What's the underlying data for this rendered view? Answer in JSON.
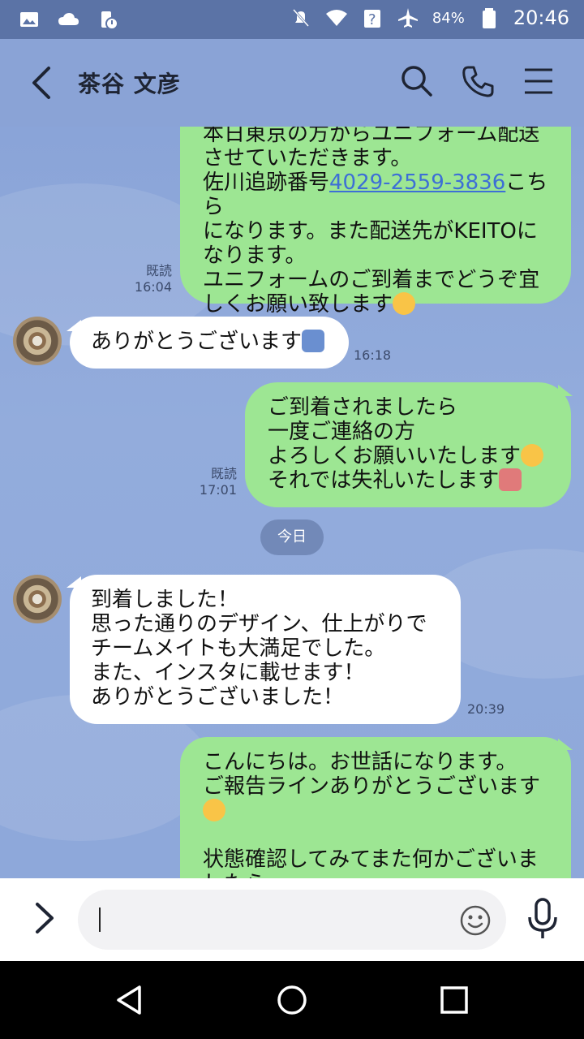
{
  "status_bar": {
    "battery": "84%",
    "time": "20:46",
    "left_icons": [
      "image-icon",
      "cloud-icon",
      "battery-alert-icon"
    ],
    "right_icons": [
      "notifications-off-icon",
      "wifi-icon",
      "signal-unknown-icon",
      "airplane-icon",
      "battery-icon"
    ]
  },
  "header": {
    "title": "茶谷 文彦",
    "icons": [
      "back-icon",
      "search-icon",
      "phone-icon",
      "menu-icon"
    ]
  },
  "messages": [
    {
      "from": "me",
      "read": "既読",
      "time": "16:04",
      "pre": "本日東京の方からユニフォーム配送\nさせていただきます。\n佐川追跡番号",
      "link": "4029-2559-3836",
      "post": "こちら\nになります。また配送先がKEITOに\nなります。\nユニフォームのご到着までどうぞ宜\nしくお願い致します"
    },
    {
      "from": "them",
      "time": "16:18",
      "text": "ありがとうございます"
    },
    {
      "from": "me",
      "read": "既読",
      "time": "17:01",
      "line1": "ご到着されましたら\n一度ご連絡の方\nよろしくお願いいたします",
      "line2": "それでは失礼いたします"
    },
    {
      "from": "them",
      "time": "20:39",
      "text": "到着しました！\n思った通りのデザイン、仕上がりで\nチームメイトも大満足でした。\nまた、インスタに載せます！\nありがとうございました！"
    },
    {
      "from": "me",
      "text1": "こんにちは。お世話になります。\nご報告ラインありがとうございます",
      "text2": "状態確認してみてまた何かございま\nしたら"
    }
  ],
  "date_divider": "今日",
  "input": {
    "placeholder": "",
    "icons": [
      "expand-icon",
      "emoji-icon",
      "mic-icon"
    ]
  },
  "nav": {
    "icons": [
      "back-nav-icon",
      "home-nav-icon",
      "recents-nav-icon"
    ]
  },
  "colors": {
    "header_bg": "#8aa3d6",
    "status_bg": "#5b73a6",
    "out_bubble": "#9de693",
    "in_bubble": "#ffffff",
    "link": "#3d6fd6"
  }
}
